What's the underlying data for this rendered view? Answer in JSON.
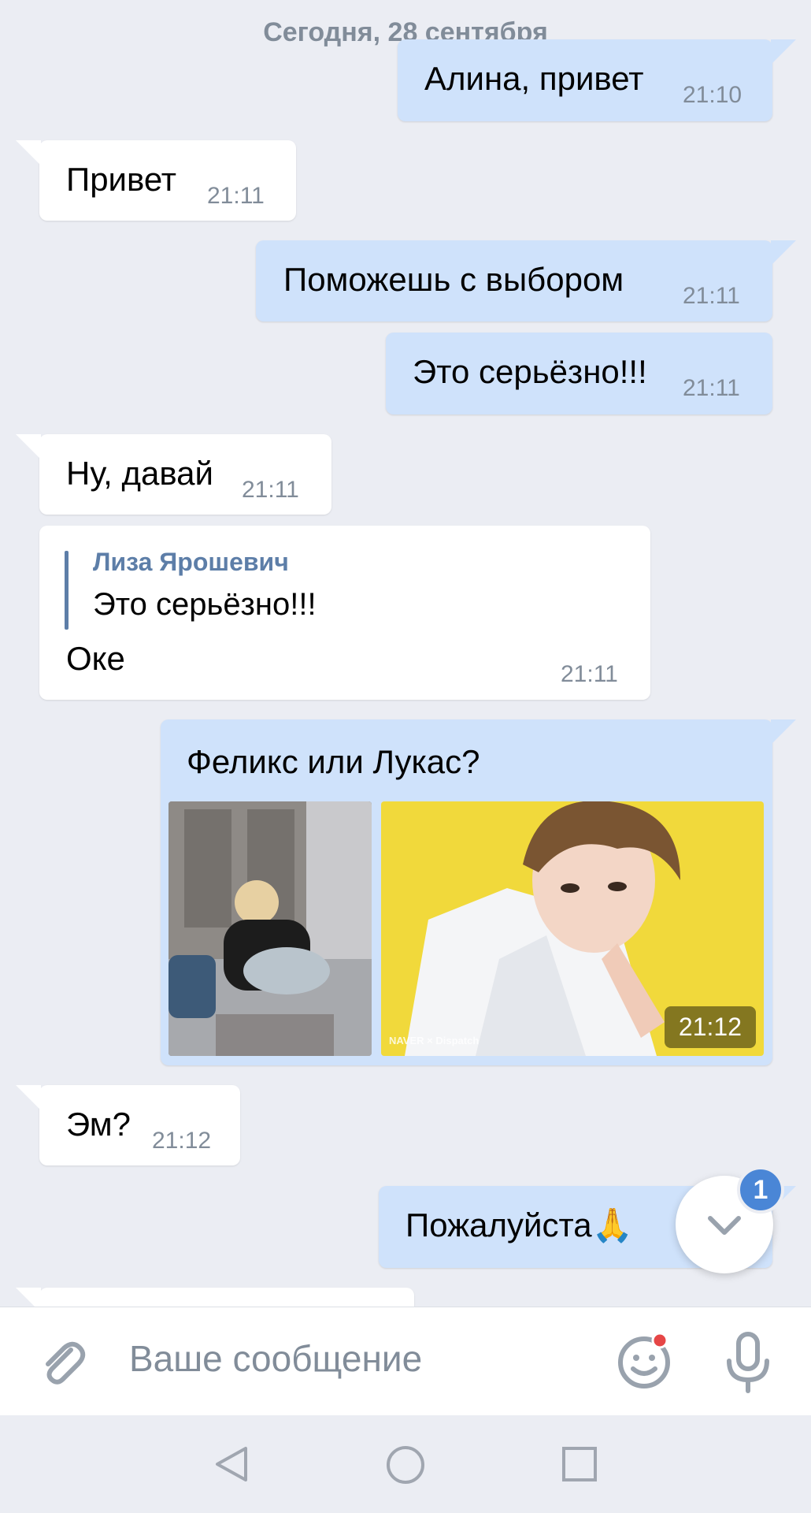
{
  "date_divider": "Сегодня, 28 сентября",
  "messages": [
    {
      "text": "Алина, привет",
      "time": "21:10"
    },
    {
      "text": "Привет",
      "time": "21:11"
    },
    {
      "text": "Поможешь с выбором",
      "time": "21:11"
    },
    {
      "text": "Это серьёзно!!!",
      "time": "21:11"
    },
    {
      "text": "Ну, давай",
      "time": "21:11"
    },
    {
      "reply_author": "Лиза Ярошевич",
      "reply_text": "Это серьёзно!!!",
      "text": "Оке",
      "time": "21:11"
    },
    {
      "text": "Феликс или Лукас?",
      "time": "21:12",
      "photo_watermark": "NAVER × Dispatch"
    },
    {
      "text": "Эм?",
      "time": "21:12"
    },
    {
      "text": "Пожалуйста🙏",
      "time": ""
    }
  ],
  "scroll_button": {
    "badge_count": "1",
    "icon": "chevron-down-icon"
  },
  "composer": {
    "placeholder": "Ваше сообщение",
    "attach_icon": "paperclip-icon",
    "emoji_icon": "emoji-icon",
    "mic_icon": "microphone-icon"
  },
  "navbar": {
    "back_icon": "back-triangle-icon",
    "home_icon": "home-circle-icon",
    "recents_icon": "recents-square-icon"
  },
  "colors": {
    "background": "#ebedf3",
    "outgoing": "#cfe2fb",
    "incoming": "#ffffff",
    "accent": "#4a86d6",
    "badge_dot": "#e64646"
  }
}
